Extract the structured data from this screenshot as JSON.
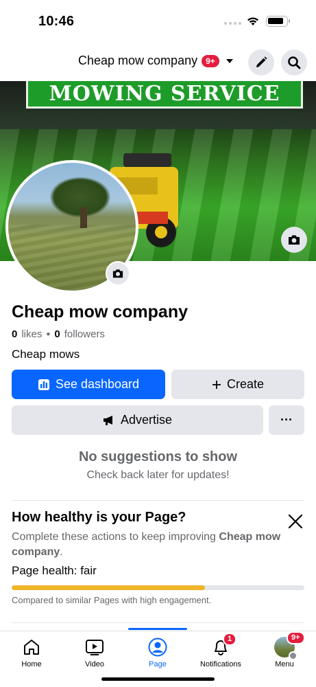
{
  "status_bar": {
    "time": "10:46"
  },
  "header": {
    "page_name": "Cheap mow company",
    "notification_badge": "9+",
    "edit_icon": "pencil-icon",
    "search_icon": "search-icon"
  },
  "cover": {
    "banner_text": "MOWING SERVICE"
  },
  "page": {
    "name": "Cheap mow company",
    "likes_count": "0",
    "likes_label": "likes",
    "followers_count": "0",
    "followers_label": "followers",
    "bio": "Cheap mows"
  },
  "actions": {
    "dashboard_label": "See dashboard",
    "create_label": "Create",
    "advertise_label": "Advertise",
    "more_label": "···"
  },
  "suggestions": {
    "title": "No suggestions to show",
    "subtitle": "Check back later for updates!"
  },
  "health": {
    "title": "How healthy is your Page?",
    "desc_prefix": "Complete these actions to keep improving ",
    "desc_page": "Cheap mow company",
    "desc_suffix": ".",
    "label_prefix": "Page health:",
    "label_value": "fair",
    "progress": 0.66,
    "progress_color": "#f0b429",
    "compare_text": "Compared to similar Pages with high engagement."
  },
  "tabbar": {
    "tabs": [
      {
        "label": "Home",
        "icon": "home-icon"
      },
      {
        "label": "Video",
        "icon": "video-icon"
      },
      {
        "label": "Page",
        "icon": "page-icon",
        "active": true
      },
      {
        "label": "Notifications",
        "icon": "bell-icon",
        "badge": "1"
      },
      {
        "label": "Menu",
        "icon": "avatar-icon",
        "badge": "9+"
      }
    ]
  },
  "colors": {
    "accent": "#0866ff",
    "badge": "#e41e3f",
    "secondary_button": "#e4e6eb"
  }
}
